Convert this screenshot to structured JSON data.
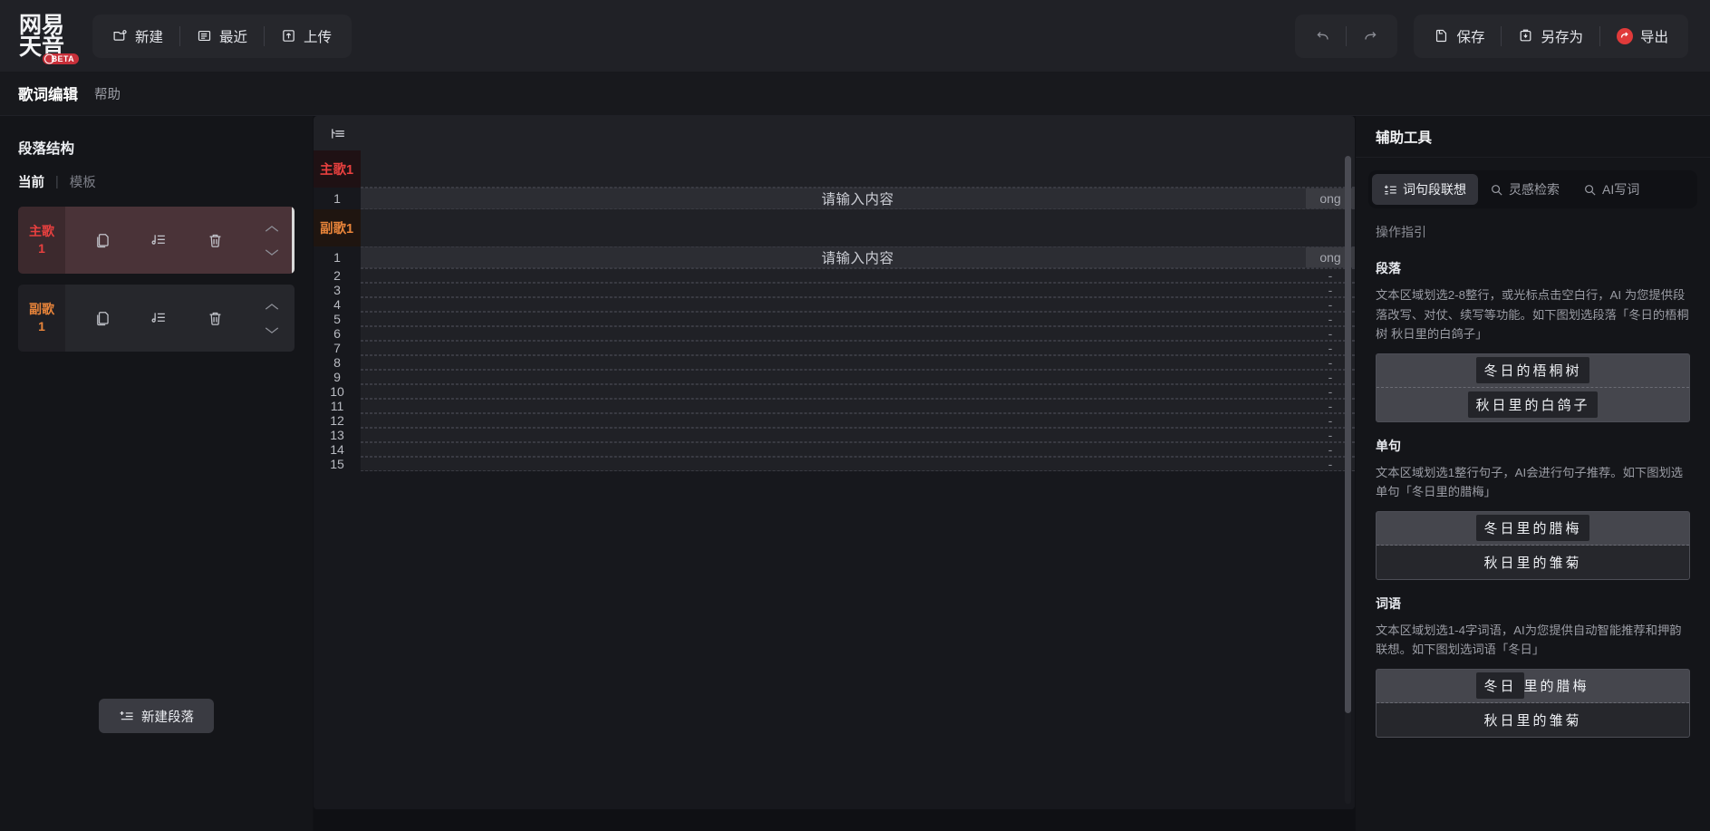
{
  "app": {
    "logo_line1": "网易",
    "logo_line2": "天音",
    "logo_badge": "BETA"
  },
  "topbar": {
    "left_buttons": [
      {
        "label": "新建",
        "icon": "new-file-icon"
      },
      {
        "label": "最近",
        "icon": "recent-icon"
      },
      {
        "label": "上传",
        "icon": "upload-icon"
      }
    ],
    "undo_icon": "undo-icon",
    "redo_icon": "redo-icon",
    "right_buttons": [
      {
        "label": "保存",
        "icon": "save-icon"
      },
      {
        "label": "另存为",
        "icon": "save-as-icon"
      },
      {
        "label": "导出",
        "icon": "export-icon"
      }
    ]
  },
  "subbar": {
    "title": "歌词编辑",
    "help": "帮助"
  },
  "left_panel": {
    "section_title": "段落结构",
    "tab_current": "当前",
    "tab_divider": "|",
    "tab_template": "模板",
    "sections": [
      {
        "type": "主歌",
        "index": "1",
        "color": "#e8403f",
        "active": true
      },
      {
        "type": "副歌",
        "index": "1",
        "color": "#e8843a",
        "active": false
      }
    ],
    "row_actions": [
      "copy-icon",
      "lyric-note-icon",
      "delete-icon"
    ],
    "arrow_up_icon": "chevron-up-icon",
    "arrow_down_icon": "chevron-down-icon",
    "new_section_button": "新建段落",
    "new_section_icon": "add-section-icon"
  },
  "editor": {
    "toolbar_icon": "indent-list-icon",
    "placeholder": "请输入内容",
    "rhyme_filled": "ong",
    "rhyme_empty": "-",
    "blocks": [
      {
        "label": "主歌1",
        "label_color": "#e8403f",
        "rows": [
          {
            "num": "1",
            "text": "请输入内容",
            "rhyme": "ong",
            "filled": true
          }
        ]
      },
      {
        "label": "副歌1",
        "label_color": "#e8843a",
        "rows": [
          {
            "num": "1",
            "text": "请输入内容",
            "rhyme": "ong",
            "filled": true
          },
          {
            "num": "2",
            "text": "",
            "rhyme": "-",
            "filled": false
          },
          {
            "num": "3",
            "text": "",
            "rhyme": "-",
            "filled": false
          },
          {
            "num": "4",
            "text": "",
            "rhyme": "-",
            "filled": false
          },
          {
            "num": "5",
            "text": "",
            "rhyme": "-",
            "filled": false
          },
          {
            "num": "6",
            "text": "",
            "rhyme": "-",
            "filled": false
          },
          {
            "num": "7",
            "text": "",
            "rhyme": "-",
            "filled": false
          },
          {
            "num": "8",
            "text": "",
            "rhyme": "-",
            "filled": false
          },
          {
            "num": "9",
            "text": "",
            "rhyme": "-",
            "filled": false
          },
          {
            "num": "10",
            "text": "",
            "rhyme": "-",
            "filled": false
          },
          {
            "num": "11",
            "text": "",
            "rhyme": "-",
            "filled": false
          },
          {
            "num": "12",
            "text": "",
            "rhyme": "-",
            "filled": false
          },
          {
            "num": "13",
            "text": "",
            "rhyme": "-",
            "filled": false
          },
          {
            "num": "14",
            "text": "",
            "rhyme": "-",
            "filled": false
          },
          {
            "num": "15",
            "text": "",
            "rhyme": "-",
            "filled": false
          }
        ]
      }
    ]
  },
  "right_panel": {
    "header": "辅助工具",
    "tabs": [
      {
        "label": "词句段联想",
        "icon": "association-icon",
        "active": true
      },
      {
        "label": "灵感检索",
        "icon": "search-icon",
        "active": false
      },
      {
        "label": "AI写词",
        "icon": "search-icon",
        "active": false
      }
    ],
    "guide_title": "操作指引",
    "groups": [
      {
        "name": "段落",
        "desc": "文本区域划选2-8整行，或光标点击空白行，AI 为您提供段落改写、对仗、续写等功能。如下图划选段落「冬日的梧桐树 秋日里的白鸽子」",
        "demo_line1": "冬日的梧桐树",
        "demo_line2": "秋日里的白鸽子"
      },
      {
        "name": "单句",
        "desc": "文本区域划选1整行句子，AI会进行句子推荐。如下图划选单句「冬日里的腊梅」",
        "demo_line1": "冬日里的腊梅",
        "demo_line2": "秋日里的雏菊"
      },
      {
        "name": "词语",
        "desc": "文本区域划选1-4字词语，AI为您提供自动智能推荐和押韵联想。如下图划选词语「冬日」",
        "demo_line1_sel": "冬日",
        "demo_line1_rest": "里的腊梅",
        "demo_line2": "秋日里的雏菊"
      }
    ]
  },
  "colors": {
    "accent_red": "#e8403f",
    "accent_orange": "#e8843a",
    "export_red": "#e03a3a",
    "bg_dark": "#18191d",
    "panel": "#141519"
  }
}
